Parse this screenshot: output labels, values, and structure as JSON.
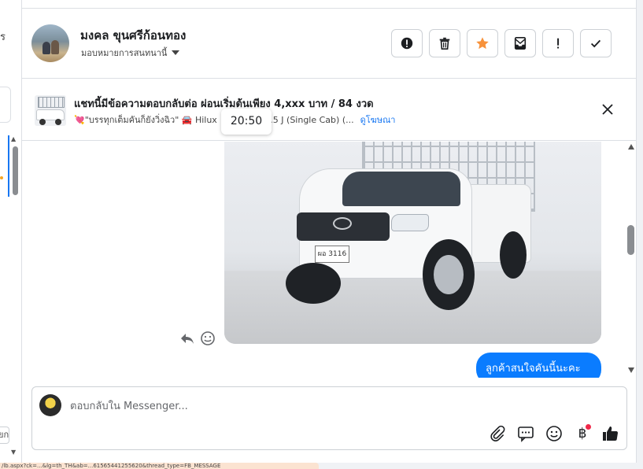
{
  "left_panel": {
    "fragment_top": "ร",
    "fragment_bottom": "ยก"
  },
  "header": {
    "contact_name": "มงคล ขุนศรีก้อนทอง",
    "assign_label": "มอบหมายการสนทนานี้",
    "actions": [
      {
        "name": "spam",
        "icon": "exclamation-circle-icon"
      },
      {
        "name": "delete",
        "icon": "trash-icon"
      },
      {
        "name": "star",
        "icon": "star-icon",
        "color": "#f7923b"
      },
      {
        "name": "move",
        "icon": "envelope-tray-icon"
      },
      {
        "name": "follow-up",
        "icon": "exclamation-icon"
      },
      {
        "name": "done",
        "icon": "check-icon"
      }
    ]
  },
  "ad_banner": {
    "title": "แชทนี้มีข้อความตอบกลับต่อ ผ่อนเริ่มต้นเพียง 4,xxx บาท / 84 งวด",
    "subtitle_prefix": "💘\"บรรทุกเต็มคันก็ยังวิ่งฉิว\" 🚘 Hilux",
    "subtitle_suffix": "p 2.5 J (Single Cab) (...",
    "link": "ดูโฆษณา"
  },
  "tooltip": {
    "time": "20:50"
  },
  "chat": {
    "photo": {
      "plate_text": "ผอ 3116"
    },
    "outgoing_message": "ลูกค้าสนใจคันนี้นะคะ"
  },
  "composer": {
    "placeholder": "ตอบกลับใน Messenger...",
    "tools": [
      "paperclip-icon",
      "speech-bubbles-icon",
      "emoji-icon",
      "baht-icon",
      "thumbs-up-icon"
    ]
  },
  "status_bar": {
    "url_fragment": "/lb.aspx?ck=...&lg=th_TH&ab=...61565441255620&thread_type=FB_MESSAGE"
  },
  "colors": {
    "accent_blue": "#0a7cff",
    "link_blue": "#1877f2",
    "star_orange": "#f7923b",
    "notification_red": "#f02849"
  }
}
